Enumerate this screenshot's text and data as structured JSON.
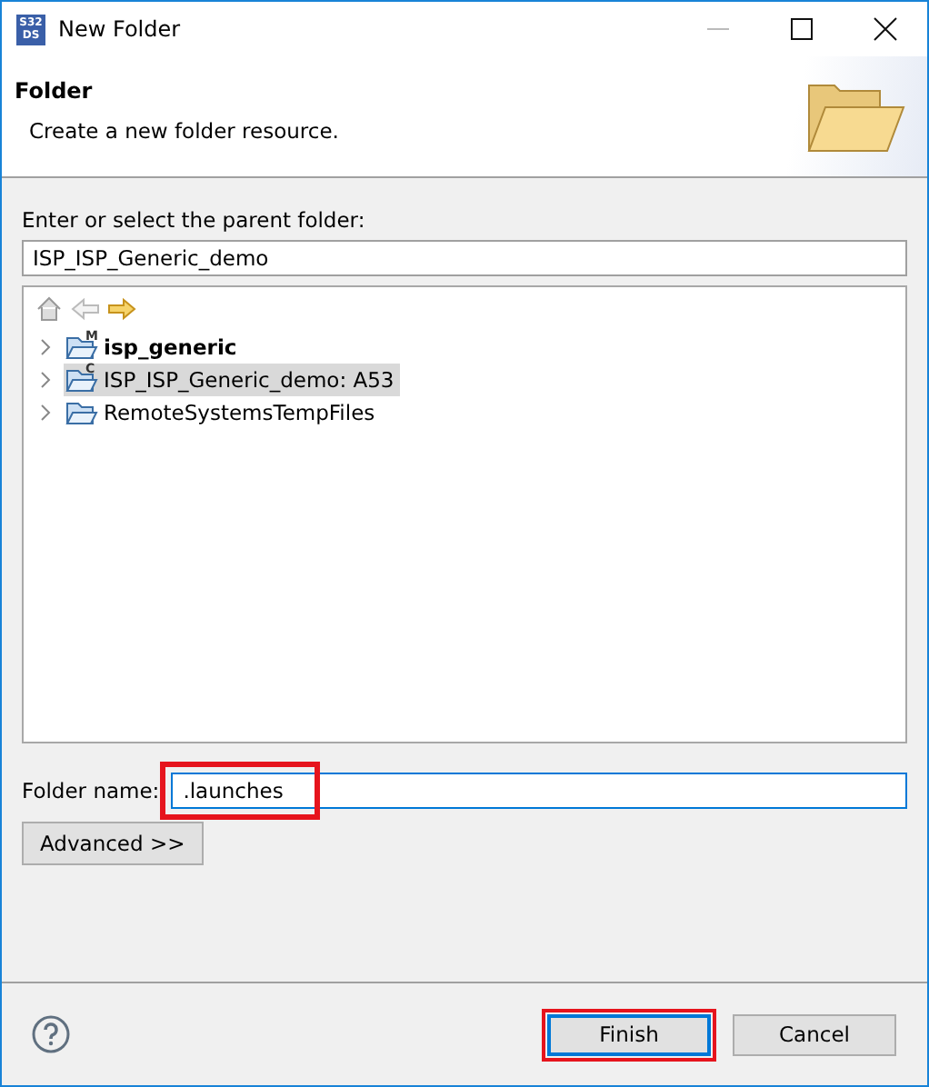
{
  "window": {
    "title": "New Folder",
    "logo_lines": [
      "S32",
      "DS"
    ]
  },
  "header": {
    "title": "Folder",
    "description": "Create a new folder resource."
  },
  "parent": {
    "label": "Enter or select the parent folder:",
    "value": "ISP_ISP_Generic_demo"
  },
  "tree": {
    "items": [
      {
        "label": "isp_generic",
        "badge": "M",
        "bold": true,
        "selected": false
      },
      {
        "label": "ISP_ISP_Generic_demo: A53",
        "badge": "C",
        "bold": false,
        "selected": true
      },
      {
        "label": "RemoteSystemsTempFiles",
        "bold": false,
        "selected": false
      }
    ]
  },
  "folder_name": {
    "label": "Folder name:",
    "value": ".launches",
    "highlighted": true
  },
  "advanced_button": "Advanced >>",
  "buttons": [
    {
      "label": "Finish",
      "default": true,
      "highlighted": true
    },
    {
      "label": "Cancel",
      "default": false,
      "highlighted": false
    }
  ]
}
